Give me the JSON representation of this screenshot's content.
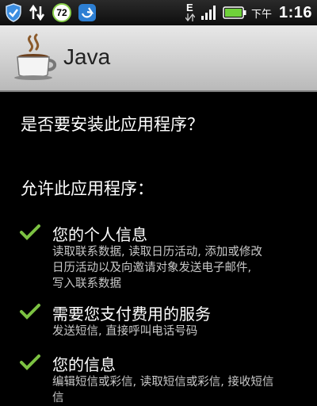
{
  "status_bar": {
    "battery_badge_value": "72",
    "network_label": "E",
    "am_pm": "下午",
    "time": "1:16",
    "icons": [
      "shield-icon",
      "sync-arrows-icon",
      "battery-72-badge-icon",
      "clean-master-icon",
      "network-e-icon",
      "signal-icon",
      "battery-icon"
    ]
  },
  "title_bar": {
    "title": "Java",
    "icon": "coffee-cup-icon"
  },
  "install": {
    "question": "是否要安装此应用程序？",
    "allow_heading": "允许此应用程序："
  },
  "permissions": [
    {
      "title": "您的个人信息",
      "desc_lines": [
        "读取联系数据, 读取日历活动, 添加或修改",
        "日历活动以及向邀请对象发送电子邮件,",
        "写入联系数据"
      ]
    },
    {
      "title": "需要您支付费用的服务",
      "desc_lines": [
        "发送短信, 直接呼叫电话号码"
      ]
    },
    {
      "title": "您的信息",
      "desc_lines": [
        "编辑短信或彩信, 读取短信或彩信, 接收短信",
        "信"
      ]
    }
  ],
  "colors": {
    "check": "#7cc242",
    "title_bar_top": "#e8e8e8",
    "badge_ring": "#8ad14a"
  }
}
